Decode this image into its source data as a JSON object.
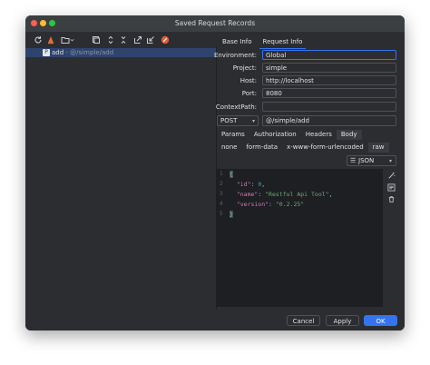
{
  "window": {
    "title": "Saved Request Records",
    "traffic_lights": [
      "#ff5f57",
      "#febc2e",
      "#28c840"
    ]
  },
  "toolbar": {
    "icons": [
      "refresh-icon",
      "delete-icon",
      "folder-icon",
      "chevron-down-icon",
      "copy-icon",
      "expand-all-icon",
      "collapse-all-icon",
      "export-icon",
      "import-icon",
      "clear-icon"
    ]
  },
  "tree": {
    "items": [
      {
        "badge": "P",
        "name": "add",
        "separator": " - ",
        "path": "@/simple/add"
      }
    ]
  },
  "tabs": [
    {
      "label": "Base Info",
      "active": false
    },
    {
      "label": "Request Info",
      "active": true
    }
  ],
  "form": {
    "environment": {
      "label": "Environment:",
      "value": "Global"
    },
    "project": {
      "label": "Project:",
      "value": "simple"
    },
    "host": {
      "label": "Host:",
      "value": "http://localhost"
    },
    "port": {
      "label": "Port:",
      "value": "8080"
    },
    "context_path": {
      "label": "ContextPath:",
      "value": ""
    }
  },
  "request": {
    "method": "POST",
    "url": "@/simple/add"
  },
  "request_tabs": [
    "Params",
    "Authorization",
    "Headers",
    "Body"
  ],
  "body_types": [
    "none",
    "form-data",
    "x-www-form-urlencoded",
    "raw"
  ],
  "body_format": "JSON",
  "editor": {
    "line_numbers": [
      "1",
      "2",
      "3",
      "4",
      "5"
    ],
    "lines": [
      "{",
      "  \"id\": 0,",
      "  \"name\": \"Restful Api Tool\",",
      "  \"version\": \"0.2.25\"",
      "}"
    ]
  },
  "side_icons": [
    "magic-wand-icon",
    "format-icon",
    "trash-icon"
  ],
  "buttons": {
    "cancel": "Cancel",
    "apply": "Apply",
    "ok": "OK"
  },
  "colors": {
    "accent": "#3574f0",
    "selection": "#2e436e",
    "background": "#2b2d30"
  }
}
